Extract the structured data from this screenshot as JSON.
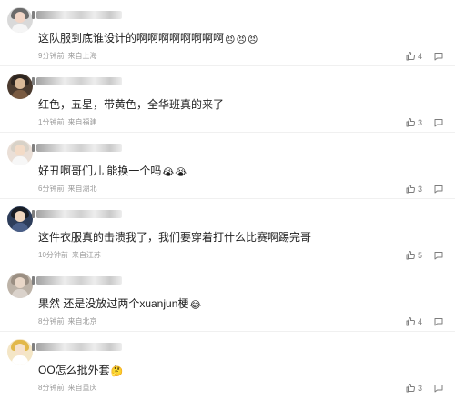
{
  "comments": [
    {
      "text": "这队服到底谁设计的啊啊啊啊啊啊啊啊",
      "emojis": [
        "😠",
        "😠",
        "😠"
      ],
      "time": "9分钟前",
      "location": "来自上海",
      "likes": "4"
    },
    {
      "text": "红色，五星，带黄色，全华班真的来了",
      "emojis": [],
      "time": "1分钟前",
      "location": "来自福建",
      "likes": "3"
    },
    {
      "text": "好丑啊哥们儿 能换一个吗",
      "emojis": [
        "😭",
        "😭"
      ],
      "time": "6分钟前",
      "location": "来自湖北",
      "likes": "3"
    },
    {
      "text": "这件衣服真的击溃我了，我们要穿着打什么比赛啊踢完哥",
      "emojis": [],
      "time": "10分钟前",
      "location": "来自江苏",
      "likes": "5"
    },
    {
      "text": "果然 还是没放过两个xuanjun梗",
      "emojis": [
        "😂"
      ],
      "time": "8分钟前",
      "location": "来自北京",
      "likes": "4"
    },
    {
      "text": "OO怎么批外套",
      "emojis": [
        "🤔"
      ],
      "time": "8分钟前",
      "location": "来自重庆",
      "likes": "3"
    }
  ],
  "icons": {
    "avatar": "avatar",
    "username": "username-blur",
    "like": "thumbs-up-icon",
    "reply": "comment-icon"
  },
  "colors": {
    "text": "#1f1f1f",
    "meta": "#9b9b9b",
    "divider": "#f0f0f0"
  }
}
